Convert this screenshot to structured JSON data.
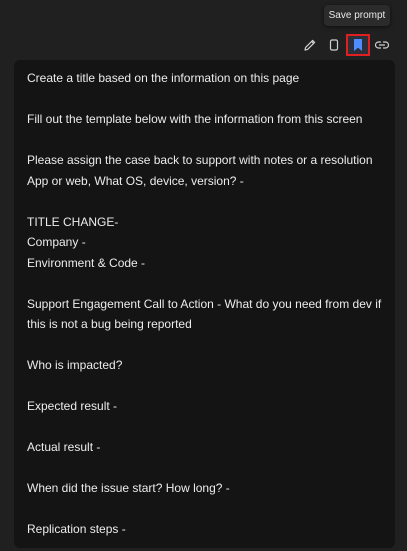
{
  "tooltip": {
    "label": "Save prompt"
  },
  "toolbar": {
    "buttons": [
      {
        "icon": "pencil-icon"
      },
      {
        "icon": "copy-icon"
      },
      {
        "icon": "bookmark-icon",
        "active": true
      },
      {
        "icon": "link-icon"
      }
    ]
  },
  "colors": {
    "highlight": "#e02020",
    "bookmark": "#4f8cff"
  },
  "prompt": {
    "paragraphs": [
      [
        "Create a title based on the information on this page"
      ],
      [
        "Fill out the template below with the information from this screen"
      ],
      [
        "Please assign the case back to support with notes or a resolution",
        "App or web, What OS, device, version? -"
      ],
      [
        "TITLE CHANGE-",
        "Company -",
        "Environment & Code -"
      ],
      [
        "Support Engagement Call to Action - What do you need from dev if",
        "this is not a bug being reported"
      ],
      [
        "Who is impacted?"
      ],
      [
        "Expected result -"
      ],
      [
        "Actual result -"
      ],
      [
        "When did the issue start? How long? -"
      ],
      [
        "Replication steps -"
      ]
    ]
  }
}
